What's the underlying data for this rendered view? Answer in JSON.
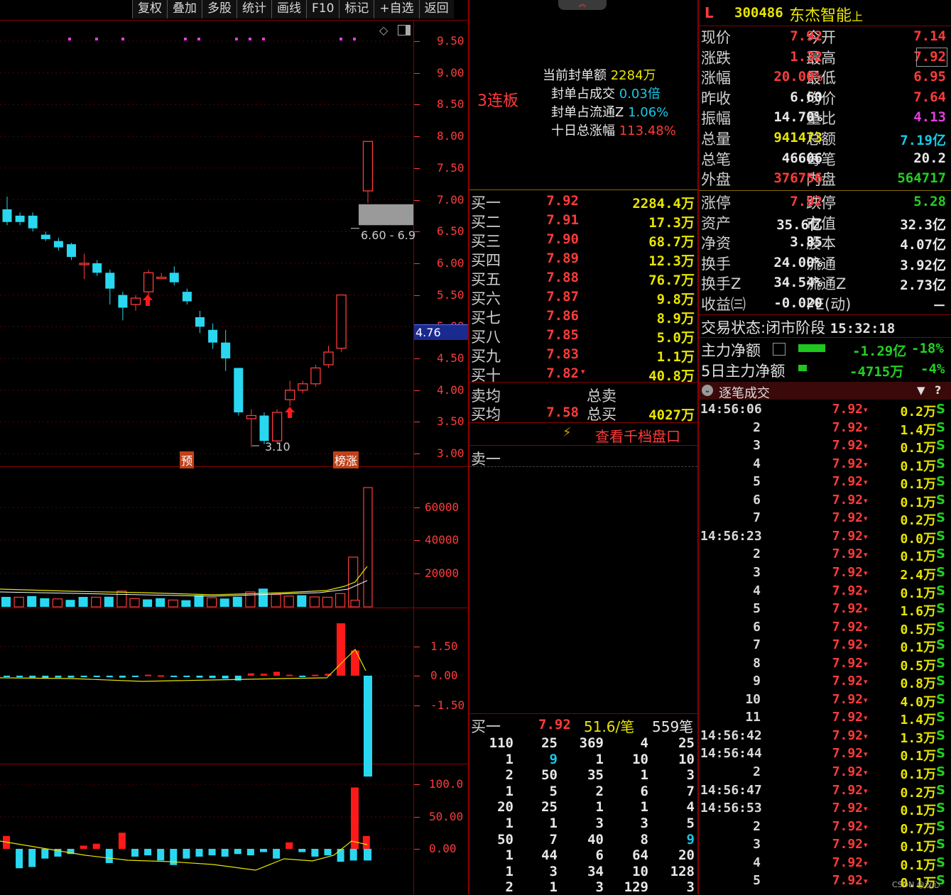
{
  "toolbar": [
    "复权",
    "叠加",
    "多股",
    "统计",
    "画线",
    "F10",
    "标记",
    "+自选",
    "返回"
  ],
  "chart": {
    "price_ticks": [
      "9.50",
      "9.00",
      "8.50",
      "8.00",
      "7.50",
      "7.00",
      "6.50",
      "6.00",
      "5.50",
      "5.00",
      "4.50",
      "4.00",
      "3.50",
      "3.00"
    ],
    "vol_ticks": [
      "60000",
      "40000",
      "20000"
    ],
    "macd_ticks": [
      "1.50",
      "0.00",
      "-1.50"
    ],
    "ind_ticks": [
      "100.0",
      "50.00",
      "0.00"
    ],
    "current_price_tag": "4.76",
    "range_label": "6.60 - 6.9",
    "low_label": "3.10",
    "marker_yu": "预",
    "marker_bangzhang": "榜涨"
  },
  "chart_data": {
    "type": "candlestick",
    "series": [
      {
        "name": "price",
        "values": [
          {
            "o": 6.85,
            "c": 6.65,
            "h": 7.05,
            "l": 6.6
          },
          {
            "o": 6.75,
            "c": 6.65,
            "h": 6.8,
            "l": 6.6
          },
          {
            "o": 6.75,
            "c": 6.55,
            "h": 6.8,
            "l": 6.5
          },
          {
            "o": 6.45,
            "c": 6.38,
            "h": 6.5,
            "l": 6.35
          },
          {
            "o": 6.35,
            "c": 6.25,
            "h": 6.4,
            "l": 6.2
          },
          {
            "o": 6.3,
            "c": 6.1,
            "h": 6.32,
            "l": 6.05
          },
          {
            "o": 6.0,
            "c": 6.0,
            "h": 6.15,
            "l": 5.75
          },
          {
            "o": 6.0,
            "c": 5.85,
            "h": 6.05,
            "l": 5.8
          },
          {
            "o": 5.85,
            "c": 5.6,
            "h": 5.9,
            "l": 5.35
          },
          {
            "o": 5.5,
            "c": 5.3,
            "h": 5.55,
            "l": 5.1
          },
          {
            "o": 5.35,
            "c": 5.45,
            "h": 5.5,
            "l": 5.25
          },
          {
            "o": 5.55,
            "c": 5.85,
            "h": 5.9,
            "l": 5.45
          },
          {
            "o": 5.78,
            "c": 5.78,
            "h": 5.85,
            "l": 5.75
          },
          {
            "o": 5.85,
            "c": 5.7,
            "h": 5.95,
            "l": 5.65
          },
          {
            "o": 5.55,
            "c": 5.4,
            "h": 5.6,
            "l": 5.35
          },
          {
            "o": 5.15,
            "c": 5.0,
            "h": 5.25,
            "l": 4.9
          },
          {
            "o": 4.95,
            "c": 4.75,
            "h": 5.05,
            "l": 4.65
          },
          {
            "o": 4.75,
            "c": 4.5,
            "h": 4.95,
            "l": 4.3
          },
          {
            "o": 4.35,
            "c": 3.65,
            "h": 4.35,
            "l": 3.6
          },
          {
            "o": 3.55,
            "c": 3.6,
            "h": 3.7,
            "l": 3.1
          },
          {
            "o": 3.6,
            "c": 3.2,
            "h": 3.65,
            "l": 3.15
          },
          {
            "o": 3.2,
            "c": 3.65,
            "h": 3.7,
            "l": 3.15
          },
          {
            "o": 3.85,
            "c": 4.0,
            "h": 4.15,
            "l": 3.75
          },
          {
            "o": 4.0,
            "c": 4.1,
            "h": 4.15,
            "l": 3.95
          },
          {
            "o": 4.1,
            "c": 4.35,
            "h": 4.4,
            "l": 4.05
          },
          {
            "o": 4.4,
            "c": 4.6,
            "h": 4.7,
            "l": 4.35
          },
          {
            "o": 4.66,
            "c": 5.5,
            "h": 5.5,
            "l": 4.6
          },
          {
            "o": 6.6,
            "c": 6.6,
            "h": 6.6,
            "l": 6.6
          },
          {
            "o": 7.14,
            "c": 7.92,
            "h": 7.92,
            "l": 6.95
          }
        ]
      },
      {
        "name": "volume",
        "values": [
          6000,
          5800,
          6500,
          5200,
          4800,
          4200,
          6000,
          5800,
          6100,
          9500,
          5000,
          4500,
          5200,
          4100,
          4000,
          7000,
          5500,
          5000,
          6100,
          9000,
          11000,
          7500,
          6500,
          7000,
          6000,
          5800,
          8000,
          30000,
          4000,
          72000
        ]
      },
      {
        "name": "macd",
        "values": [
          -0.05,
          -0.08,
          -0.1,
          -0.12,
          -0.1,
          -0.1,
          -0.08,
          -0.06,
          -0.08,
          -0.1,
          -0.05,
          0.05,
          0.02,
          -0.04,
          -0.06,
          -0.1,
          -0.12,
          -0.15,
          -0.25,
          0.12,
          0.1,
          0.2,
          0.05,
          -0.05,
          0.05,
          0.1,
          2.7,
          1.3,
          -5.2
        ]
      },
      {
        "name": "indicator",
        "values": [
          20,
          -30,
          -28,
          -15,
          -12,
          -8,
          5,
          8,
          -22,
          25,
          -12,
          -10,
          -18,
          -25,
          -15,
          -12,
          -10,
          -12,
          -8,
          -10,
          -5,
          -15,
          10,
          -5,
          -12,
          -10,
          -20,
          -18,
          20,
          95,
          -18
        ]
      }
    ],
    "ylim": [
      3.0,
      9.6
    ]
  },
  "status": {
    "limit_streak": "3连板",
    "seal_amount_label": "当前封单额",
    "seal_amount_value": "2284万",
    "seal_ratio_trade_label": "封单占成交",
    "seal_ratio_trade_value": "0.03倍",
    "seal_ratio_float_label": "封单占流通Z",
    "seal_ratio_float_value": "1.06%",
    "ten_day_label": "十日总涨幅",
    "ten_day_value": "113.48%"
  },
  "header": {
    "market": "L",
    "code": "300486",
    "name": "东杰智能",
    "suffix": "上"
  },
  "quote": [
    {
      "l1": "现价",
      "v1": "7.92",
      "c1": "red",
      "l2": "今开",
      "v2": "7.14",
      "c2": "red"
    },
    {
      "l1": "涨跌",
      "v1": "1.32",
      "c1": "red",
      "l2": "最高",
      "v2": "7.92",
      "c2": "red"
    },
    {
      "l1": "涨幅",
      "v1": "20.00%",
      "c1": "red",
      "l2": "最低",
      "v2": "6.95",
      "c2": "red"
    },
    {
      "l1": "昨收",
      "v1": "6.60",
      "c1": "white",
      "l2": "均价",
      "v2": "7.64",
      "c2": "red"
    },
    {
      "l1": "振幅",
      "v1": "14.70%",
      "c1": "white",
      "l2": "量比",
      "v2": "4.13",
      "c2": "magenta"
    },
    {
      "l1": "总量",
      "v1": "941473",
      "c1": "yellow",
      "l2": "总额",
      "v2": "7.19亿",
      "c2": "cyan"
    },
    {
      "l1": "总笔",
      "v1": "46606",
      "c1": "white",
      "l2": "每笔",
      "v2": "20.2",
      "c2": "white"
    },
    {
      "l1": "外盘",
      "v1": "376756",
      "c1": "red",
      "l2": "内盘",
      "v2": "564717",
      "c2": "green"
    }
  ],
  "fundamentals": [
    {
      "l1": "涨停",
      "v1": "7.92",
      "c1": "red",
      "l2": "跌停",
      "v2": "5.28",
      "c2": "green"
    },
    {
      "l1": "资产",
      "v1": "35.6亿",
      "c1": "white",
      "l2": "市值",
      "v2": "32.3亿",
      "c2": "white"
    },
    {
      "l1": "净资",
      "v1": "3.85",
      "c1": "white",
      "l2": "股本",
      "v2": "4.07亿",
      "c2": "white"
    },
    {
      "l1": "换手",
      "v1": "24.00%",
      "c1": "white",
      "l2": "流通",
      "v2": "3.92亿",
      "c2": "white"
    },
    {
      "l1": "换手Z",
      "v1": "34.54%",
      "c1": "white",
      "l2": "流通Z",
      "v2": "2.73亿",
      "c2": "white"
    },
    {
      "l1": "收益㈢",
      "v1": "-0.020",
      "c1": "white",
      "l2": "PE(动)",
      "v2": "－",
      "c2": "white"
    }
  ],
  "trade_status": {
    "label": "交易状态:",
    "value": "闭市阶段",
    "time": "15:32:18"
  },
  "main_flow": {
    "label": "主力净额",
    "value": "-1.29亿",
    "pct": "-18%"
  },
  "main_flow5": {
    "label": "5日主力净额",
    "value": "-4715万",
    "pct": "-4%"
  },
  "orderbook": {
    "bids": [
      {
        "label": "买一",
        "price": "7.92",
        "vol": "2284.4万"
      },
      {
        "label": "买二",
        "price": "7.91",
        "vol": "17.3万"
      },
      {
        "label": "买三",
        "price": "7.90",
        "vol": "68.7万"
      },
      {
        "label": "买四",
        "price": "7.89",
        "vol": "12.3万"
      },
      {
        "label": "买五",
        "price": "7.88",
        "vol": "76.7万"
      },
      {
        "label": "买六",
        "price": "7.87",
        "vol": "9.8万"
      },
      {
        "label": "买七",
        "price": "7.86",
        "vol": "8.9万"
      },
      {
        "label": "买八",
        "price": "7.85",
        "vol": "5.0万"
      },
      {
        "label": "买九",
        "price": "7.83",
        "vol": "1.1万"
      },
      {
        "label": "买十",
        "price": "7.82",
        "vol": "40.8万"
      }
    ],
    "ask_avg_label": "卖均",
    "total_sell_label": "总卖",
    "bid_avg_label": "买均",
    "bid_avg": "7.58",
    "total_buy_label": "总买",
    "total_buy": "4027万",
    "depth_button": "查看千档盘口",
    "sell1_label": "卖一",
    "queue_header": {
      "label": "买一",
      "price": "7.92",
      "avg": "51.6/笔",
      "count": "559笔"
    },
    "queue": [
      [
        "110",
        "25",
        "369",
        "4",
        "25"
      ],
      [
        "1",
        "9",
        "1",
        "10",
        "10"
      ],
      [
        "2",
        "50",
        "35",
        "1",
        "3"
      ],
      [
        "1",
        "5",
        "2",
        "6",
        "7"
      ],
      [
        "20",
        "25",
        "1",
        "1",
        "4"
      ],
      [
        "1",
        "1",
        "3",
        "3",
        "5"
      ],
      [
        "50",
        "7",
        "40",
        "8",
        "9"
      ],
      [
        "1",
        "44",
        "6",
        "64",
        "20"
      ],
      [
        "1",
        "3",
        "34",
        "10",
        "128"
      ],
      [
        "2",
        "1",
        "3",
        "129",
        "3"
      ]
    ]
  },
  "ticks_title": "逐笔成交",
  "ticks": [
    {
      "t": "14:56:06",
      "p": "7.92",
      "v": "0.2万",
      "s": "S"
    },
    {
      "t": "2",
      "p": "7.92",
      "v": "1.4万",
      "s": "S"
    },
    {
      "t": "3",
      "p": "7.92",
      "v": "0.1万",
      "s": "S"
    },
    {
      "t": "4",
      "p": "7.92",
      "v": "0.1万",
      "s": "S"
    },
    {
      "t": "5",
      "p": "7.92",
      "v": "0.1万",
      "s": "S"
    },
    {
      "t": "6",
      "p": "7.92",
      "v": "0.1万",
      "s": "S"
    },
    {
      "t": "7",
      "p": "7.92",
      "v": "0.2万",
      "s": "S"
    },
    {
      "t": "14:56:23",
      "p": "7.92",
      "v": "0.0万",
      "s": "S"
    },
    {
      "t": "2",
      "p": "7.92",
      "v": "0.1万",
      "s": "S"
    },
    {
      "t": "3",
      "p": "7.92",
      "v": "2.4万",
      "s": "S"
    },
    {
      "t": "4",
      "p": "7.92",
      "v": "0.1万",
      "s": "S"
    },
    {
      "t": "5",
      "p": "7.92",
      "v": "1.6万",
      "s": "S"
    },
    {
      "t": "6",
      "p": "7.92",
      "v": "0.5万",
      "s": "S"
    },
    {
      "t": "7",
      "p": "7.92",
      "v": "0.1万",
      "s": "S"
    },
    {
      "t": "8",
      "p": "7.92",
      "v": "0.5万",
      "s": "S"
    },
    {
      "t": "9",
      "p": "7.92",
      "v": "0.8万",
      "s": "S"
    },
    {
      "t": "10",
      "p": "7.92",
      "v": "4.0万",
      "s": "S"
    },
    {
      "t": "11",
      "p": "7.92",
      "v": "1.4万",
      "s": "S"
    },
    {
      "t": "14:56:42",
      "p": "7.92",
      "v": "1.3万",
      "s": "S"
    },
    {
      "t": "14:56:44",
      "p": "7.92",
      "v": "0.1万",
      "s": "S"
    },
    {
      "t": "2",
      "p": "7.92",
      "v": "0.1万",
      "s": "S"
    },
    {
      "t": "14:56:47",
      "p": "7.92",
      "v": "0.2万",
      "s": "S"
    },
    {
      "t": "14:56:53",
      "p": "7.92",
      "v": "0.1万",
      "s": "S"
    },
    {
      "t": "2",
      "p": "7.92",
      "v": "0.7万",
      "s": "S"
    },
    {
      "t": "3",
      "p": "7.92",
      "v": "0.1万",
      "s": "S"
    },
    {
      "t": "4",
      "p": "7.92",
      "v": "0.1万",
      "s": "S"
    },
    {
      "t": "5",
      "p": "7.92",
      "v": "0.1万",
      "s": "S"
    }
  ],
  "watermark": "CSDN @汉心"
}
